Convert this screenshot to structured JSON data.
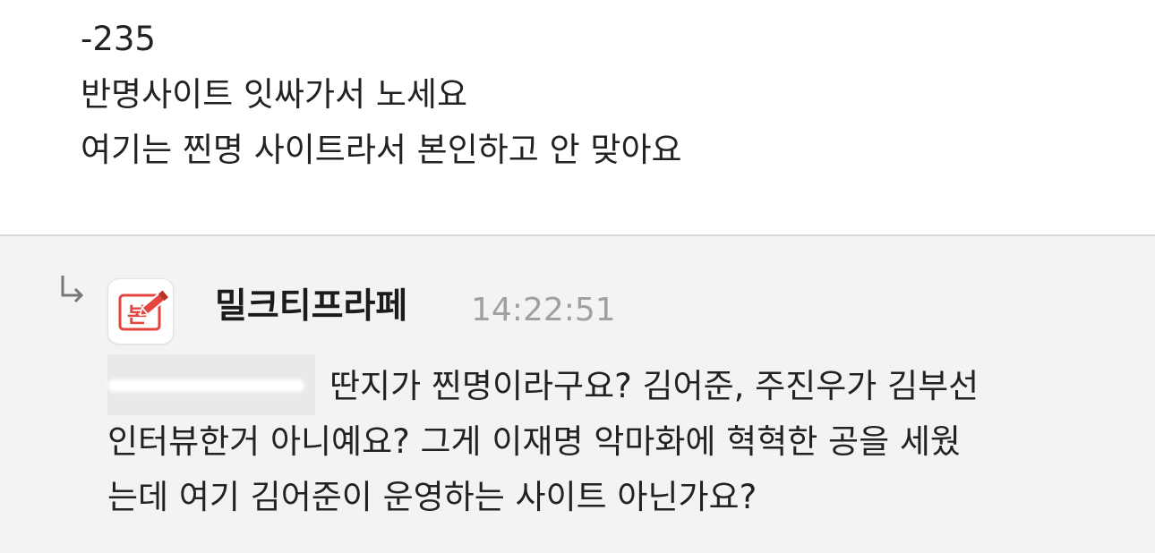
{
  "parent_comment": {
    "lines": [
      "-235",
      "반명사이트 잇싸가서 노세요",
      "여기는 찐명 사이트라서 본인하고 안 맞아요"
    ]
  },
  "reply": {
    "reply_icon": "reply-arrow-icon",
    "avatar_icon": "edit-document-icon",
    "avatar_text": "본",
    "author": "밀크티프라페",
    "time": "14:22:51",
    "mention_redacted": true,
    "body_lines": [
      "딴지가 찐명이라구요? 김어준, 주진우가 김부선",
      "인터뷰한거 아니예요? 그게 이재명 악마화에 혁혁한 공을 세웠",
      "는데 여기 김어준이 운영하는 사이트 아닌가요?"
    ]
  },
  "colors": {
    "background_top": "#ffffff",
    "background_reply": "#f3f3f3",
    "divider": "#dadada",
    "text": "#222222",
    "timestamp": "#a0a0a0",
    "avatar_accent": "#e2463f"
  }
}
